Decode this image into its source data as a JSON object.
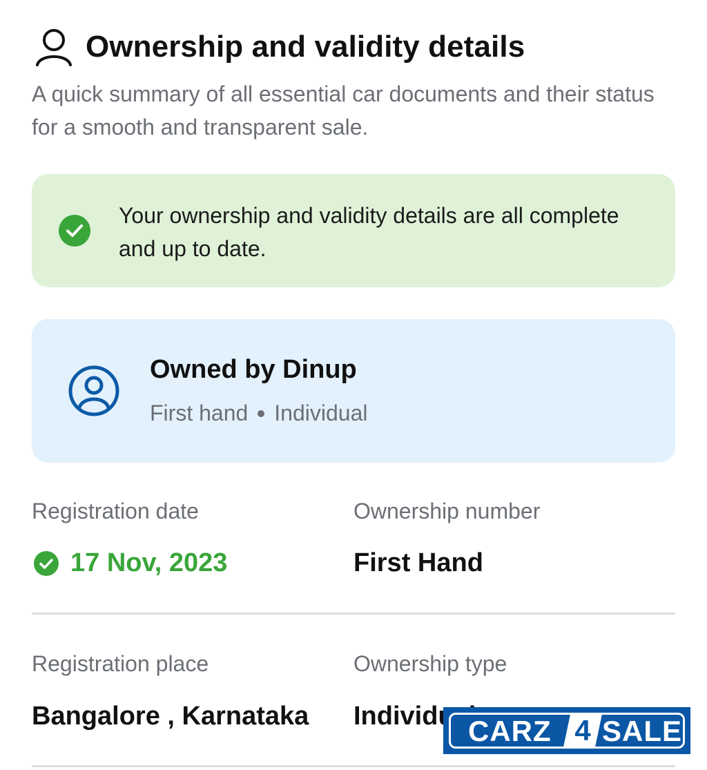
{
  "header": {
    "icon": "user-outline-icon",
    "title": "Ownership and validity details",
    "subtitle": "A quick summary of all essential car documents and their status for a smooth and transparent sale."
  },
  "banner": {
    "icon": "check-circle-icon",
    "text": "Your ownership and validity details are all complete and up to date.",
    "background": "#dff2d8",
    "accent": "#3aa63a"
  },
  "owner_card": {
    "icon": "user-circle-icon",
    "name": "Owned by Dinup",
    "hand": "First hand",
    "type": "Individual",
    "background": "#e3f1fc",
    "accent": "#0b5aa6"
  },
  "details": [
    {
      "label": "Registration date",
      "value": "17 Nov, 2023",
      "verified": true
    },
    {
      "label": "Ownership number",
      "value": "First Hand"
    },
    {
      "label": "Registration place",
      "value": "Bangalore , Karnataka"
    },
    {
      "label": "Ownership type",
      "value": "Individual"
    }
  ],
  "watermark": {
    "text_left": "CARZ",
    "text_mid": "4",
    "text_right": "SALE",
    "color": "#0b57a5"
  }
}
